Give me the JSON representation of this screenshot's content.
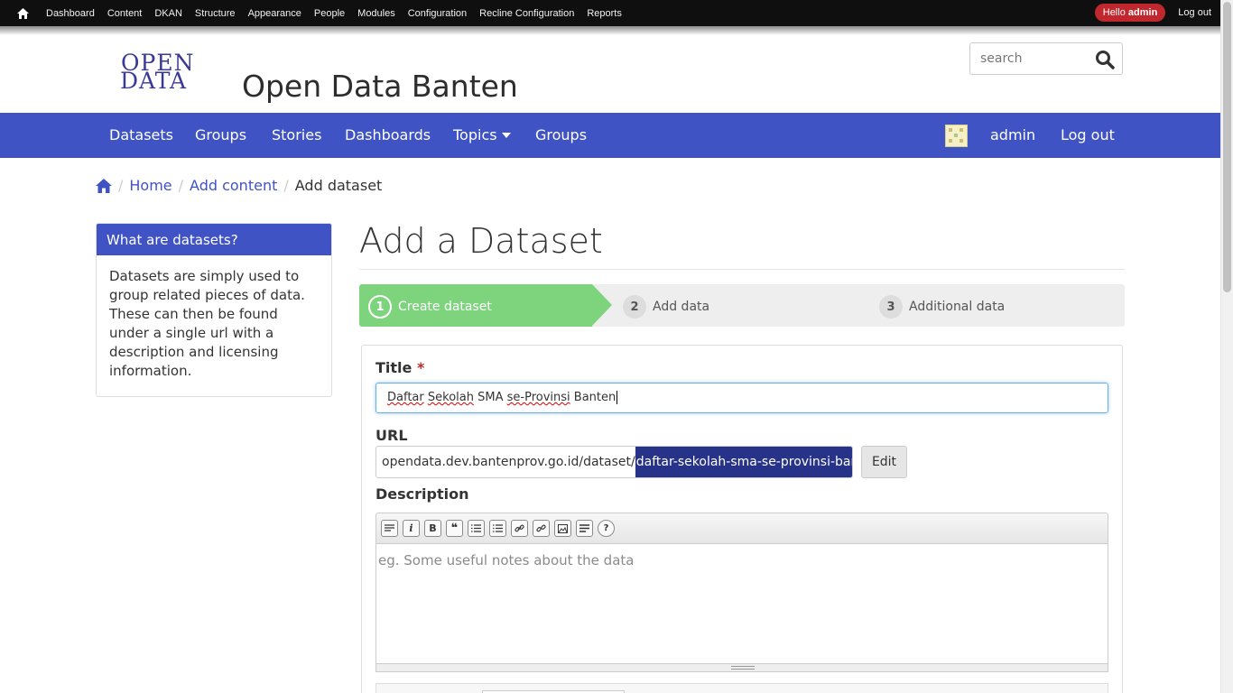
{
  "admin_bar": {
    "items": [
      "Dashboard",
      "Content",
      "DKAN",
      "Structure",
      "Appearance",
      "People",
      "Modules",
      "Configuration",
      "Recline Configuration",
      "Reports"
    ],
    "hello_prefix": "Hello",
    "hello_user": "admin",
    "logout": "Log out"
  },
  "header": {
    "logo_line1": "OPEN",
    "logo_line2": "DATA",
    "site_name": "Open Data Banten",
    "search_placeholder": "search"
  },
  "main_nav": {
    "items": [
      "Datasets",
      "Groups",
      "Stories",
      "Dashboards",
      "Topics",
      "Groups"
    ],
    "user": "admin",
    "logout": "Log out"
  },
  "breadcrumb": [
    "Home",
    "Add content",
    "Add dataset"
  ],
  "sidebar": {
    "title": "What are datasets?",
    "body": "Datasets are simply used to group related pieces of data. These can then be found under a single url with a description and licensing information."
  },
  "page": {
    "title": "Add a Dataset"
  },
  "steps": [
    {
      "num": "1",
      "label": "Create dataset"
    },
    {
      "num": "2",
      "label": "Add data"
    },
    {
      "num": "3",
      "label": "Additional data"
    }
  ],
  "form": {
    "title_label": "Title",
    "required_mark": "*",
    "title_value_a": "Daftar",
    "title_value_b": "Sekolah",
    "title_value_c": "SMA",
    "title_value_d": "se-Provinsi",
    "title_value_e": "Banten",
    "url_label": "URL",
    "url_prefix": "opendata.dev.bantenprov.go.id/dataset/",
    "url_slug": "daftar-sekolah-sma-se-provinsi-banten",
    "edit_button": "Edit",
    "description_label": "Description",
    "description_placeholder": "eg. Some useful notes about the data",
    "toolbar_buttons": [
      "format-icon",
      "italic-icon",
      "bold-icon",
      "blockquote-icon",
      "numbered-list-icon",
      "bullet-list-icon",
      "link-icon",
      "unlink-icon",
      "image-icon",
      "justify-icon",
      "help-icon"
    ]
  },
  "colors": {
    "admin_bar": "#0f0f0f",
    "primary": "#4053c4",
    "step_active": "#7dd47d",
    "badge_red": "#c0282e",
    "url_slug_bg": "#273389"
  }
}
